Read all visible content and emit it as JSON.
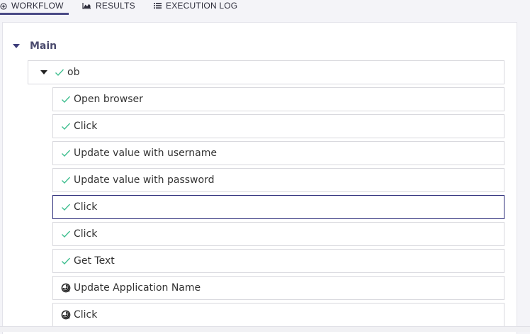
{
  "tabs": [
    {
      "id": "workflow",
      "label": "WORKFLOW",
      "icon": "circle-plus-icon",
      "active": true
    },
    {
      "id": "results",
      "label": "RESULTS",
      "icon": "area-chart-icon",
      "active": false
    },
    {
      "id": "log",
      "label": "EXECUTION LOG",
      "icon": "list-icon",
      "active": false
    }
  ],
  "main": {
    "label": "Main"
  },
  "group": {
    "label": "ob",
    "status": "success"
  },
  "steps": [
    {
      "label": "Open browser",
      "status": "success"
    },
    {
      "label": "Click",
      "status": "success"
    },
    {
      "label": "Update value with username",
      "status": "success"
    },
    {
      "label": "Update value with password",
      "status": "success"
    },
    {
      "label": "Click",
      "status": "success",
      "selected": true
    },
    {
      "label": "Click",
      "status": "success"
    },
    {
      "label": "Get Text",
      "status": "success"
    },
    {
      "label": "Update Application Name",
      "status": "pending"
    },
    {
      "label": "Click",
      "status": "pending"
    }
  ],
  "colors": {
    "accent": "#4a4a86",
    "success": "#3fbf8f"
  }
}
